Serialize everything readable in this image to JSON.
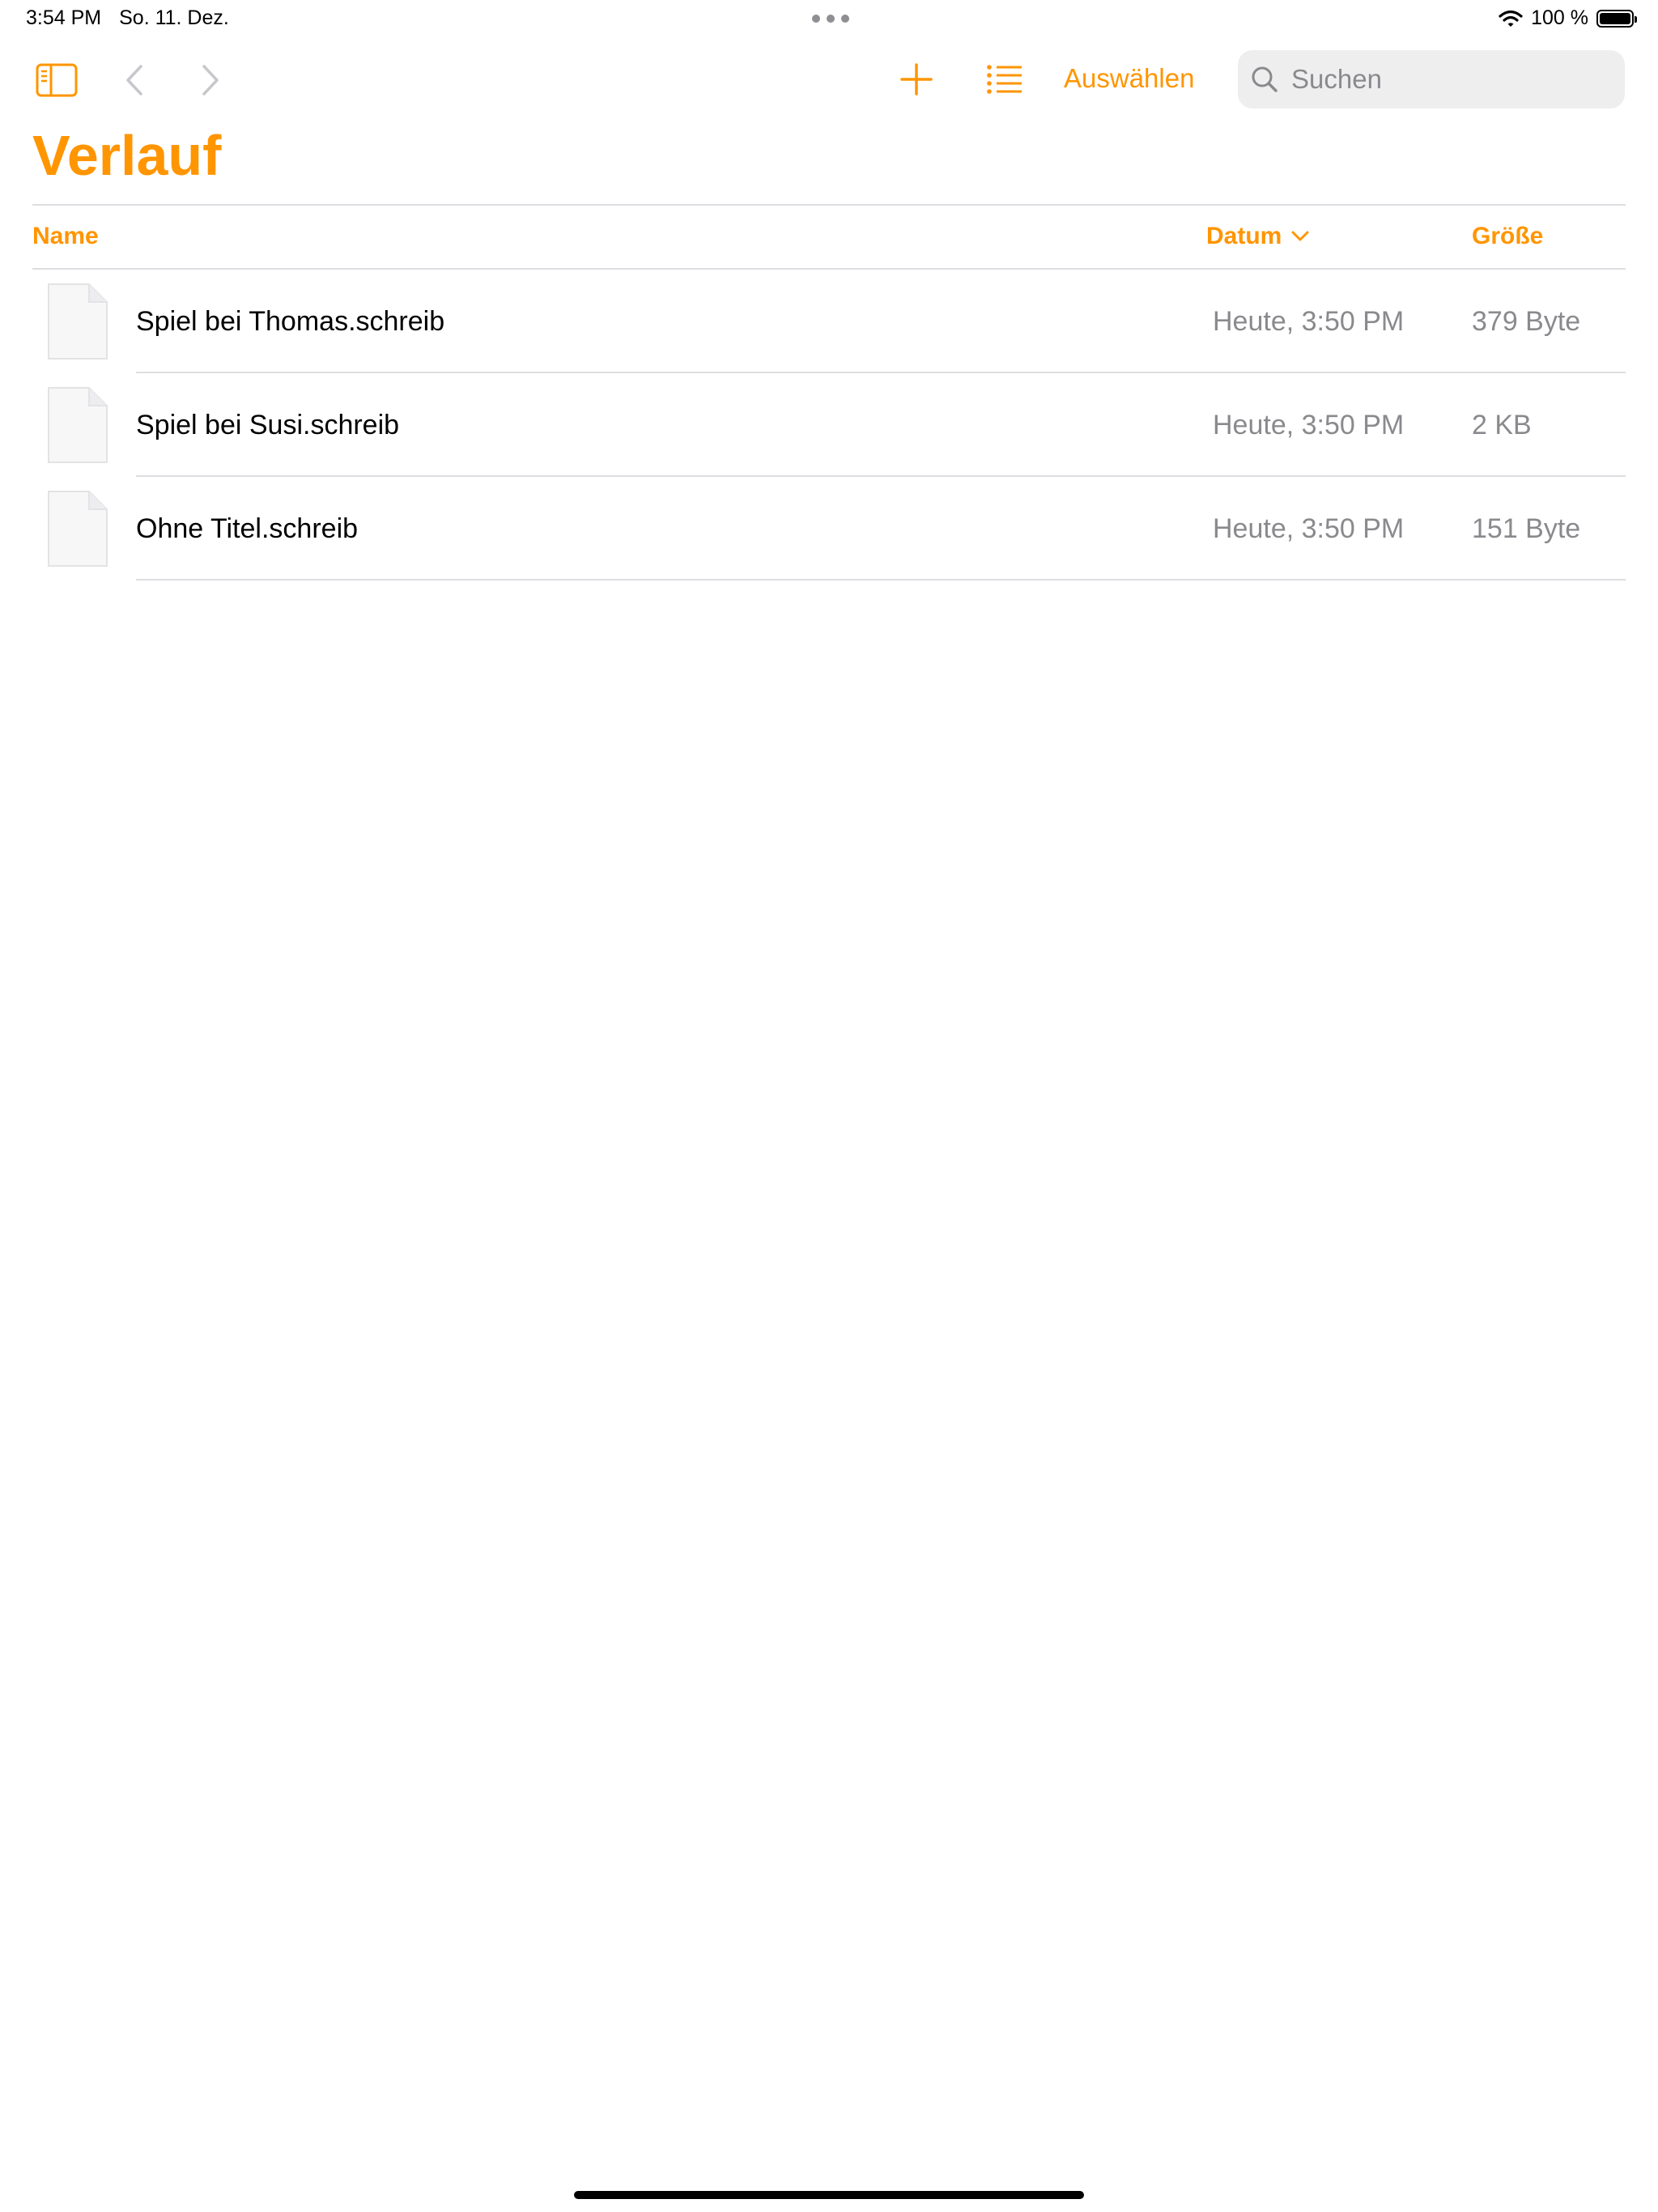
{
  "status_bar": {
    "time": "3:54 PM",
    "date": "So. 11. Dez.",
    "battery_percent": "100 %",
    "battery_level": 1.0,
    "wifi_icon": "wifi-icon"
  },
  "toolbar": {
    "sidebar_icon": "sidebar-toggle-icon",
    "back_icon": "chevron-left-icon",
    "forward_icon": "chevron-right-icon",
    "add_icon": "plus-icon",
    "view_icon": "list-view-icon",
    "select_label": "Auswählen",
    "search_placeholder": "Suchen",
    "search_value": ""
  },
  "title": "Verlauf",
  "table": {
    "columns": {
      "name": "Name",
      "date": "Datum",
      "size": "Größe"
    },
    "sort_column": "date",
    "rows": [
      {
        "name": "Spiel bei Thomas.schreib",
        "date": "Heute, 3:50 PM",
        "size": "379 Byte"
      },
      {
        "name": "Spiel bei Susi.schreib",
        "date": "Heute, 3:50 PM",
        "size": "2 KB"
      },
      {
        "name": "Ohne Titel.schreib",
        "date": "Heute, 3:50 PM",
        "size": "151 Byte"
      }
    ]
  },
  "colors": {
    "accent": "#ff9500",
    "secondary_text": "#8a8a8e",
    "separator": "#dedee2",
    "search_bg": "#eeeeef"
  }
}
